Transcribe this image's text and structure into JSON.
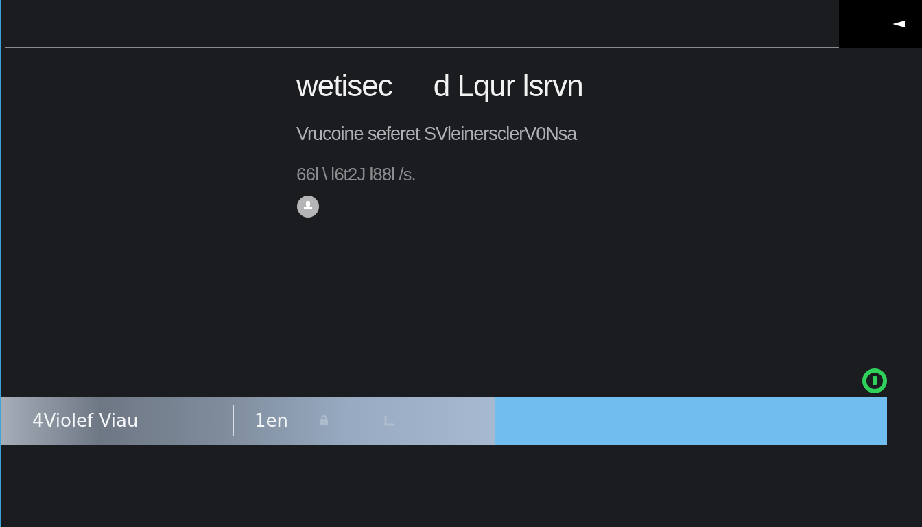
{
  "content": {
    "title_parts": [
      "wetisec",
      "d Lqur lsrvn"
    ],
    "subtitle": "Vrucoine seferet SVleinersclerV0Nsa",
    "meta": "66l \\ l6t2J l88l /s."
  },
  "status_indicator": {
    "on": true
  },
  "bottom_bar": {
    "label": "4Violef Viau",
    "value": "1en"
  }
}
